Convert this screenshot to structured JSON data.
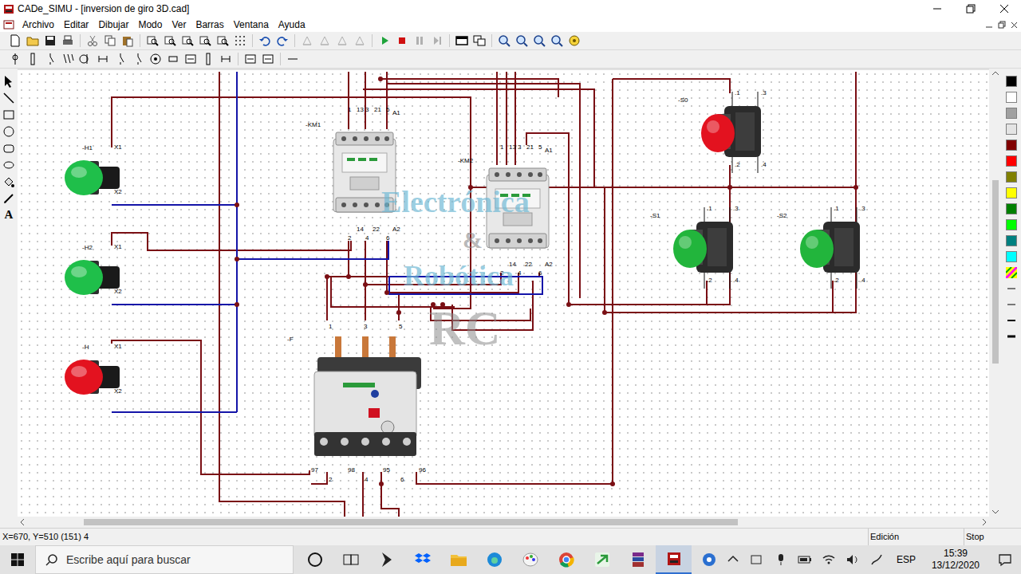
{
  "window": {
    "title": "CADe_SIMU - [inversion de giro 3D.cad]"
  },
  "menu": [
    "Archivo",
    "Editar",
    "Dibujar",
    "Modo",
    "Ver",
    "Barras",
    "Ventana",
    "Ayuda"
  ],
  "tools": {
    "text_tool": "A"
  },
  "canvas": {
    "lamps": [
      {
        "tag": "-H1",
        "x1": "X1",
        "x2": "X2",
        "color": "#1fbf4a"
      },
      {
        "tag": "-H2",
        "x1": "X1",
        "x2": "X2",
        "color": "#1fbf4a"
      },
      {
        "tag": "-H",
        "x1": "X1",
        "x2": "X2",
        "color": "#e3121f"
      }
    ],
    "contactors": [
      {
        "tag": "-KM1",
        "top": [
          "1",
          "13",
          "3",
          "21",
          "5",
          "A1"
        ],
        "bottom": [
          "2",
          "14",
          "4",
          "22",
          "6",
          "A2"
        ]
      },
      {
        "tag": "-KM2",
        "top": [
          "1",
          "13",
          "3",
          "21",
          "5",
          "A1"
        ],
        "bottom": [
          "2",
          "14",
          "4",
          "22",
          "6",
          "A2"
        ]
      }
    ],
    "overload": {
      "tag": "-F",
      "top": [
        "1",
        "3",
        "5"
      ],
      "bottom": [
        "97",
        "2",
        "98",
        "4",
        "95",
        "6",
        "96"
      ]
    },
    "pushbuttons": [
      {
        "tag": "-S0",
        "terminals": [
          ".1",
          ".3",
          ".2",
          ".4"
        ],
        "color": "#e3121f"
      },
      {
        "tag": "-S1",
        "terminals": [
          ".1",
          ".3",
          ".2",
          ".4"
        ],
        "color": "#22b53c"
      },
      {
        "tag": "-S2",
        "terminals": [
          ".1",
          ".3",
          ".2",
          ".4"
        ],
        "color": "#22b53c"
      }
    ],
    "watermark": [
      "Electrónica",
      "&",
      "Robótica",
      "RC"
    ]
  },
  "palette": {
    "colors": [
      "#000000",
      "#ffffff",
      "#a0a0a0",
      "#e4e4e4",
      "#800000",
      "#ff0000",
      "#808000",
      "#ffff00",
      "#008000",
      "#00ff00",
      "#008080",
      "#00ffff"
    ]
  },
  "status_bar": {
    "coords": "X=670, Y=510 (151) 4",
    "mode": "Edición",
    "simulation": "Stop"
  },
  "taskbar": {
    "search": "Escribe aquí para buscar",
    "apps": [
      {
        "kind": "cortana",
        "selected": false
      },
      {
        "kind": "taskview",
        "selected": false
      },
      {
        "kind": "powerapp",
        "selected": false
      },
      {
        "kind": "dropbox",
        "selected": false
      },
      {
        "kind": "folder",
        "selected": false
      },
      {
        "kind": "edge",
        "selected": false
      },
      {
        "kind": "paint",
        "selected": false
      },
      {
        "kind": "chrome",
        "selected": false
      },
      {
        "kind": "arrowapp",
        "selected": false
      },
      {
        "kind": "winrar",
        "selected": false
      },
      {
        "kind": "cadesimu",
        "selected": true
      }
    ],
    "language": "ESP",
    "time": "15:39",
    "date": "13/12/2020"
  }
}
